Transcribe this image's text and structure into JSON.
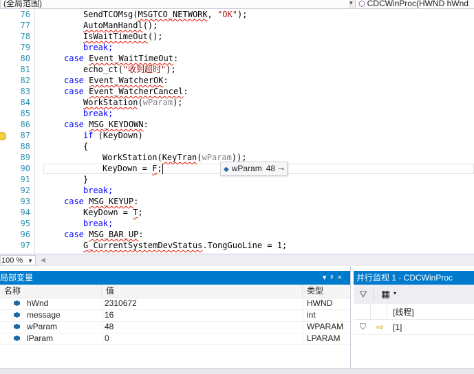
{
  "nav": {
    "scope_label": "(全局范围)",
    "method_label": "CDCWinProc(HWND hWnd"
  },
  "editor": {
    "lines": [
      {
        "num": "76",
        "code": "SendTCOMsg(MSGTCO_NETWORK, \"OK\");"
      },
      {
        "num": "77",
        "code": "AutoManHandl();"
      },
      {
        "num": "78",
        "code": "IsWaitTimeOut();"
      },
      {
        "num": "79",
        "code": "break;"
      },
      {
        "num": "80",
        "code": "case Event_WaitTimeOut:"
      },
      {
        "num": "81",
        "code": "echo_ct(\"收到超时\");"
      },
      {
        "num": "82",
        "code": "case Event_WatcherOK:"
      },
      {
        "num": "83",
        "code": "case Event_WatcherCancel:"
      },
      {
        "num": "84",
        "code": "WorkStation(wParam);"
      },
      {
        "num": "85",
        "code": "break;"
      },
      {
        "num": "86",
        "code": "case MSG_KEYDOWN:"
      },
      {
        "num": "87",
        "code": "if (KeyDown)"
      },
      {
        "num": "88",
        "code": "{"
      },
      {
        "num": "89",
        "code": "WorkStation(KeyTran(wParam));"
      },
      {
        "num": "90",
        "code": "KeyDown = F;"
      },
      {
        "num": "91",
        "code": "}"
      },
      {
        "num": "92",
        "code": "break;"
      },
      {
        "num": "93",
        "code": "case MSG_KEYUP:"
      },
      {
        "num": "94",
        "code": "KeyDown = T;"
      },
      {
        "num": "95",
        "code": "break;"
      },
      {
        "num": "96",
        "code": "case MSG_BAR_UP:"
      },
      {
        "num": "97",
        "code": "G_CurrentSystemDevStatus.TongGuoLine = 1;"
      }
    ],
    "datatip": {
      "name": "wParam",
      "value": "48"
    }
  },
  "zoom": {
    "level": "100 %"
  },
  "locals": {
    "title": "局部变量",
    "columns": {
      "name": "名称",
      "value": "值",
      "type": "类型"
    },
    "rows": [
      {
        "name": "hWnd",
        "value": "2310672",
        "type": "HWND"
      },
      {
        "name": "message",
        "value": "16",
        "type": "int"
      },
      {
        "name": "wParam",
        "value": "48",
        "type": "WPARAM"
      },
      {
        "name": "lParam",
        "value": "0",
        "type": "LPARAM"
      }
    ]
  },
  "parallel_watch": {
    "title": "并行监视 1 - CDCWinProc",
    "column_thread": "[线程]",
    "row_thread": "[1]"
  },
  "colors": {
    "keyword": "#0000ff",
    "param": "#808080",
    "string": "#a31515",
    "line_number": "#2b91af",
    "panel_title": "#007acc"
  }
}
